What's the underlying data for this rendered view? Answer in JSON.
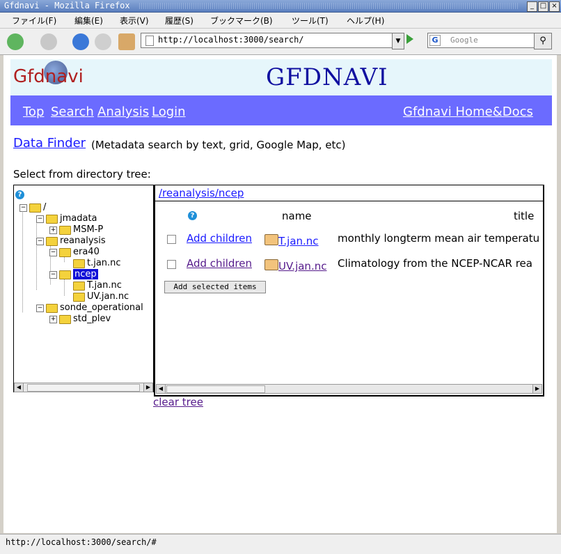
{
  "window": {
    "title": "Gfdnavi - Mozilla Firefox"
  },
  "menu": [
    "ファイル(F)",
    "編集(E)",
    "表示(V)",
    "履歴(S)",
    "ブックマーク(B)",
    "ツール(T)",
    "ヘルプ(H)"
  ],
  "nav": {
    "url": "http://localhost:3000/search/",
    "search_placeholder": "Google"
  },
  "header": {
    "logo_text": "Gfdnavi",
    "site_title": "GFDNAVI"
  },
  "topnav": {
    "top": "Top",
    "search": "Search",
    "analysis": "Analysis",
    "login": "Login",
    "home_docs": "Gfdnavi Home&Docs"
  },
  "main": {
    "data_finder": "Data Finder ",
    "data_finder_desc": "(Metadata search by text, grid, Google Map, etc)",
    "select_label": "Select from directory tree:"
  },
  "tree": {
    "root": "/",
    "nodes": [
      "jmadata",
      "MSM-P",
      "reanalysis",
      "era40",
      "t.jan.nc",
      "ncep",
      "T.jan.nc",
      "UV.jan.nc",
      "sonde_operational",
      "std_plev"
    ]
  },
  "listing": {
    "path": "/reanalysis/ncep",
    "col_name": "name",
    "col_title": "title",
    "rows": [
      {
        "action": "Add children",
        "name": "T.jan.nc",
        "title": "monthly longterm mean air temperatu"
      },
      {
        "action": "Add children",
        "name": "UV.jan.nc",
        "title": "Climatology from the NCEP-NCAR rea"
      }
    ],
    "add_selected": "Add selected items"
  },
  "clear_tree": "clear tree",
  "status": "http://localhost:3000/search/#",
  "colors": {
    "topnav_bg": "#6b6bff",
    "header_bg": "#e6f6fb",
    "site_title": "#1010a0",
    "logo": "#b02020",
    "selected": "#1010d8"
  }
}
